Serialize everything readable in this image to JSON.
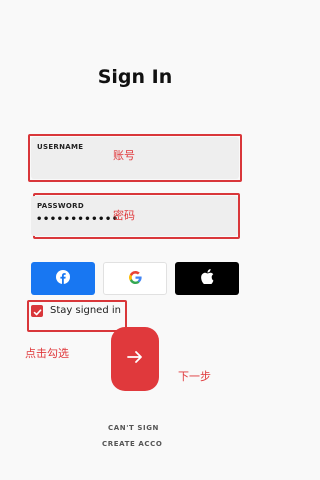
{
  "page": {
    "title": "Sign In"
  },
  "username": {
    "label": "USERNAME",
    "value": "",
    "annotation": "账号"
  },
  "password": {
    "label": "PASSWORD",
    "value": "••••••••••••",
    "annotation": "密码"
  },
  "social": {
    "facebook_icon": "facebook-icon",
    "google_icon": "google-icon",
    "apple_icon": "apple-icon",
    "colors": {
      "facebook": "#1877f2",
      "google_bg": "#ffffff",
      "apple": "#000000"
    }
  },
  "stay_signed_in": {
    "label": "Stay signed in",
    "checked": true,
    "annotation": "点击勾选"
  },
  "next": {
    "annotation": "下一步",
    "icon": "arrow-right-icon"
  },
  "footer": {
    "cant_sign_in": "CAN'T SIGN",
    "create_account": "CREATE ACCO"
  },
  "colors": {
    "accent": "#e0393c",
    "annotation": "#d9373a"
  }
}
